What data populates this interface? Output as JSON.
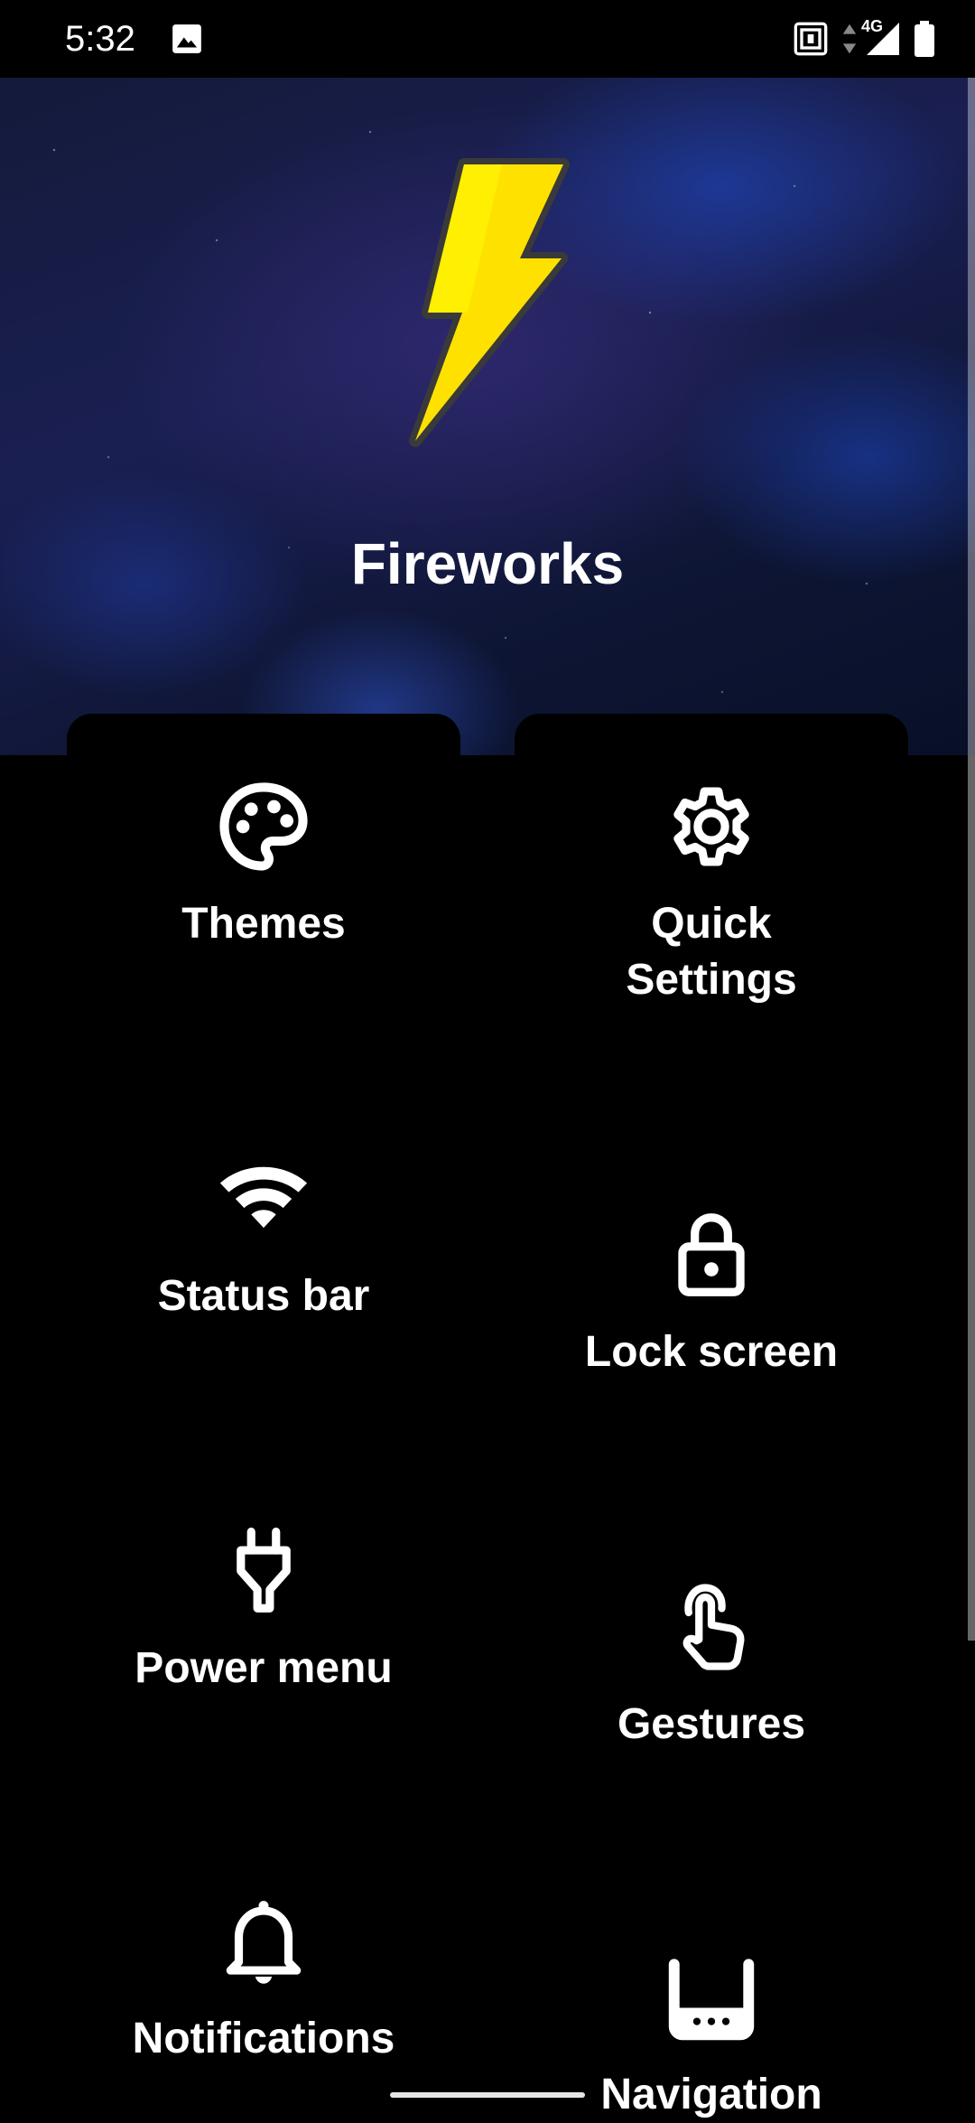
{
  "status_bar": {
    "time": "5:32",
    "network": "4G",
    "icons": [
      "gallery-icon",
      "nfc-icon",
      "data-arrows-icon",
      "signal-icon",
      "battery-icon"
    ]
  },
  "header": {
    "title": "Fireworks",
    "logo": "lightning-bolt-icon",
    "accent_color": "#FFE100"
  },
  "tiles": [
    {
      "label": "Themes",
      "icon": "palette-icon"
    },
    {
      "label": "Quick\nSettings",
      "icon": "gear-icon"
    },
    {
      "label": "Status bar",
      "icon": "wifi-icon"
    },
    {
      "label": "Lock screen",
      "icon": "lock-icon"
    },
    {
      "label": "Power menu",
      "icon": "plug-icon"
    },
    {
      "label": "Gestures",
      "icon": "touch-icon"
    },
    {
      "label": "Notifications",
      "icon": "bell-icon"
    },
    {
      "label": "Navigation",
      "icon": "navigation-bar-icon"
    }
  ]
}
